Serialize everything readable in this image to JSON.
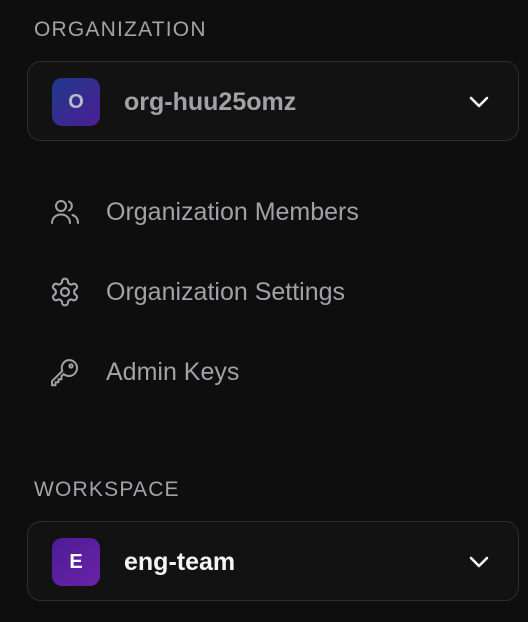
{
  "organization": {
    "section_label": "ORGANIZATION",
    "selector": {
      "avatar_letter": "O",
      "name": "org-huu25omz"
    },
    "menu": [
      {
        "label": "Organization Members",
        "icon": "users-icon"
      },
      {
        "label": "Organization Settings",
        "icon": "gear-icon"
      },
      {
        "label": "Admin Keys",
        "icon": "key-icon"
      }
    ]
  },
  "workspace": {
    "section_label": "WORKSPACE",
    "selector": {
      "avatar_letter": "E",
      "name": "eng-team"
    }
  },
  "colors": {
    "background": "#0e0e0f",
    "border": "#2e2e31",
    "text_muted": "#a1a1a6",
    "text_bright": "#f5f5f7",
    "org_avatar_gradient": [
      "#1e3a8a",
      "#4c1d95"
    ],
    "ws_avatar_gradient": [
      "#4c1d95",
      "#6b21a8"
    ]
  }
}
